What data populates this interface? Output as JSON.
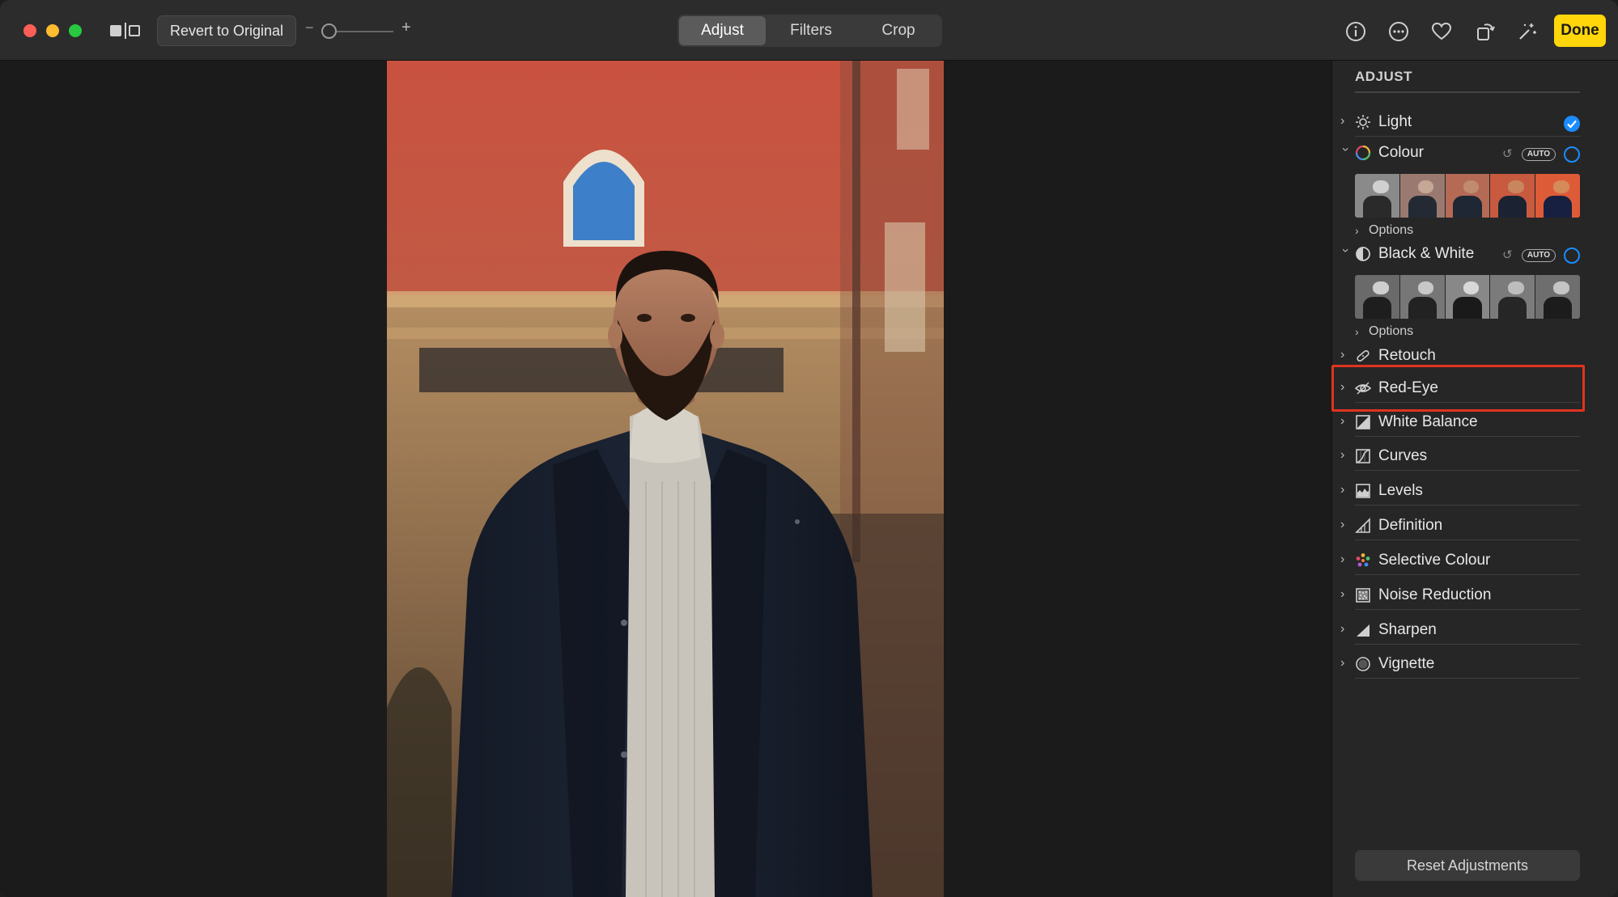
{
  "toolbar": {
    "revert_label": "Revert to Original",
    "zoom_minus": "−",
    "zoom_plus": "+",
    "zoom_level": 0.0,
    "tabs": [
      {
        "label": "Adjust",
        "active": true
      },
      {
        "label": "Filters",
        "active": false
      },
      {
        "label": "Crop",
        "active": false
      }
    ],
    "icons": [
      "info-icon",
      "more-icon",
      "heart-icon",
      "rotate-icon",
      "magic-wand-icon"
    ],
    "done_label": "Done"
  },
  "sidebar": {
    "title": "ADJUST",
    "items": [
      {
        "label": "Light",
        "icon": "sun-icon",
        "state": "checked"
      },
      {
        "label": "Colour",
        "icon": "colour-ring-icon",
        "state": "expanded",
        "auto": "AUTO",
        "options": "Options"
      },
      {
        "label": "Black & White",
        "icon": "half-circle-icon",
        "state": "expanded",
        "auto": "AUTO",
        "options": "Options"
      },
      {
        "label": "Retouch",
        "icon": "bandage-icon"
      },
      {
        "label": "Red-Eye",
        "icon": "eye-icon",
        "highlighted": true
      },
      {
        "label": "White Balance",
        "icon": "white-balance-icon"
      },
      {
        "label": "Curves",
        "icon": "curves-icon"
      },
      {
        "label": "Levels",
        "icon": "levels-icon"
      },
      {
        "label": "Definition",
        "icon": "definition-icon"
      },
      {
        "label": "Selective Colour",
        "icon": "selective-colour-icon"
      },
      {
        "label": "Noise Reduction",
        "icon": "noise-reduction-icon"
      },
      {
        "label": "Sharpen",
        "icon": "sharpen-icon"
      },
      {
        "label": "Vignette",
        "icon": "vignette-icon"
      }
    ],
    "reset_label": "Reset Adjustments"
  },
  "colors": {
    "accent": "#1a8cff",
    "done": "#ffd60a",
    "highlight": "#e0331f"
  }
}
